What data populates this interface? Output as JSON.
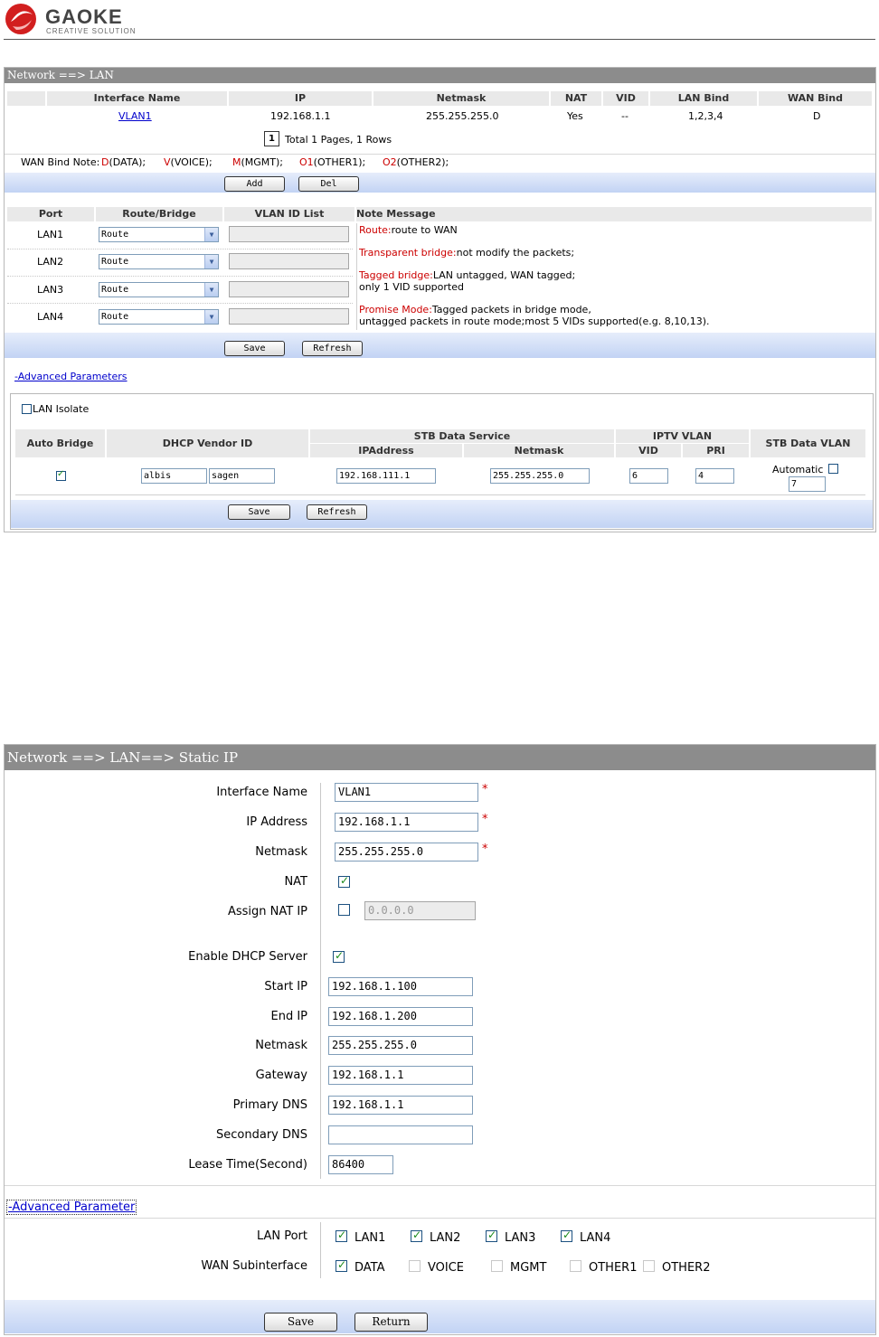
{
  "brand": {
    "name": "GAOKE",
    "tagline": "CREATIVE SOLUTION"
  },
  "lan": {
    "title": "Network ==> LAN",
    "columns": [
      "Interface Name",
      "IP",
      "Netmask",
      "NAT",
      "VID",
      "LAN Bind",
      "WAN Bind"
    ],
    "rows": [
      {
        "interface": "VLAN1",
        "ip": "192.168.1.1",
        "netmask": "255.255.255.0",
        "nat": "Yes",
        "vid": "--",
        "lan_bind": "1,2,3,4",
        "wan_bind": "D"
      }
    ],
    "pager": {
      "page": "1",
      "summary": "Total 1 Pages, 1 Rows"
    },
    "wan_note": {
      "label": "WAN Bind Note:",
      "items": [
        {
          "code": "D",
          "desc": "(DATA);"
        },
        {
          "code": "V",
          "desc": "(VOICE);"
        },
        {
          "code": "M",
          "desc": "(MGMT);"
        },
        {
          "code": "O1",
          "desc": "(OTHER1);"
        },
        {
          "code": "O2",
          "desc": "(OTHER2);"
        }
      ]
    },
    "add_label": "Add",
    "del_label": "Del",
    "port_columns": [
      "Port",
      "Route/Bridge",
      "VLAN ID List",
      "Note Message"
    ],
    "ports": [
      {
        "port": "LAN1",
        "mode": "Route",
        "vlan_list": ""
      },
      {
        "port": "LAN2",
        "mode": "Route",
        "vlan_list": ""
      },
      {
        "port": "LAN3",
        "mode": "Route",
        "vlan_list": ""
      },
      {
        "port": "LAN4",
        "mode": "Route",
        "vlan_list": ""
      }
    ],
    "notes": {
      "route_key": "Route:",
      "route_text": "route to WAN",
      "transparent_key": "Transparent bridge:",
      "transparent_text": "not modify the packets;",
      "tagged_key": "Tagged bridge:",
      "tagged_text": "LAN untagged, WAN tagged;",
      "tagged_text2": "only 1 VID supported",
      "promise_key": "Promise Mode:",
      "promise_text": "Tagged packets in bridge mode,",
      "promise_text2": "untagged packets in route mode;most 5 VIDs supported(e.g. 8,10,13)."
    },
    "save_label": "Save",
    "refresh_label": "Refresh",
    "advanced_link": "-Advanced Parameters",
    "lan_isolate_label": "LAN Isolate",
    "lan_isolate_checked": false,
    "stb": {
      "auto_bridge": "Auto Bridge",
      "dhcp_vendor": "DHCP Vendor ID",
      "stb_data_service": "STB Data Service",
      "ip_address": "IPAddress",
      "netmask": "Netmask",
      "iptv_vlan": "IPTV VLAN",
      "vid": "VID",
      "pri": "PRI",
      "stb_data_vlan": "STB Data VLAN",
      "auto_bridge_checked": true,
      "vendor1": "albis",
      "vendor2": "sagen",
      "ip_value": "192.168.111.1",
      "netmask_value": "255.255.255.0",
      "vid_value": "6",
      "pri_value": "4",
      "automatic_label": "Automatic",
      "automatic_checked": false,
      "vlan_value": "7"
    },
    "save2_label": "Save",
    "refresh2_label": "Refresh"
  },
  "static_ip": {
    "title": "Network ==> LAN==> Static IP",
    "interface_name_label": "Interface Name",
    "interface_name_value": "VLAN1",
    "ip_address_label": "IP Address",
    "ip_address_value": "192.168.1.1",
    "netmask_label": "Netmask",
    "netmask_value": "255.255.255.0",
    "required_mark": "*",
    "nat_label": "NAT",
    "nat_checked": true,
    "assign_nat_ip_label": "Assign NAT IP",
    "assign_nat_ip_checked": false,
    "assign_nat_ip_value": "0.0.0.0",
    "dhcp_label": "Enable DHCP Server",
    "dhcp_checked": true,
    "start_ip_label": "Start IP",
    "start_ip_value": "192.168.1.100",
    "end_ip_label": "End IP",
    "end_ip_value": "192.168.1.200",
    "dhcp_netmask_label": "Netmask",
    "dhcp_netmask_value": "255.255.255.0",
    "gateway_label": "Gateway",
    "gateway_value": "192.168.1.1",
    "primary_dns_label": "Primary DNS",
    "primary_dns_value": "192.168.1.1",
    "secondary_dns_label": "Secondary DNS",
    "secondary_dns_value": "",
    "lease_label": "Lease Time(Second)",
    "lease_value": "86400",
    "advanced_link": "-Advanced Parameter",
    "lan_port_label": "LAN Port",
    "lan_ports": [
      {
        "label": "LAN1",
        "checked": true
      },
      {
        "label": "LAN2",
        "checked": true
      },
      {
        "label": "LAN3",
        "checked": true
      },
      {
        "label": "LAN4",
        "checked": true
      }
    ],
    "wan_sub_label": "WAN Subinterface",
    "wan_subs": [
      {
        "label": "DATA",
        "checked": true
      },
      {
        "label": "VOICE",
        "checked": false
      },
      {
        "label": "MGMT",
        "checked": false
      },
      {
        "label": "OTHER1",
        "checked": false
      },
      {
        "label": "OTHER2",
        "checked": false
      }
    ],
    "save_label": "Save",
    "return_label": "Return"
  },
  "colors": {
    "title_bar": "#8c8c8c",
    "header_cell": "#e9e9e9",
    "link": "#0000cc",
    "note_key": "#cc0000",
    "check": "#1a8a1a",
    "blue_bar": "#c2d3f4"
  }
}
